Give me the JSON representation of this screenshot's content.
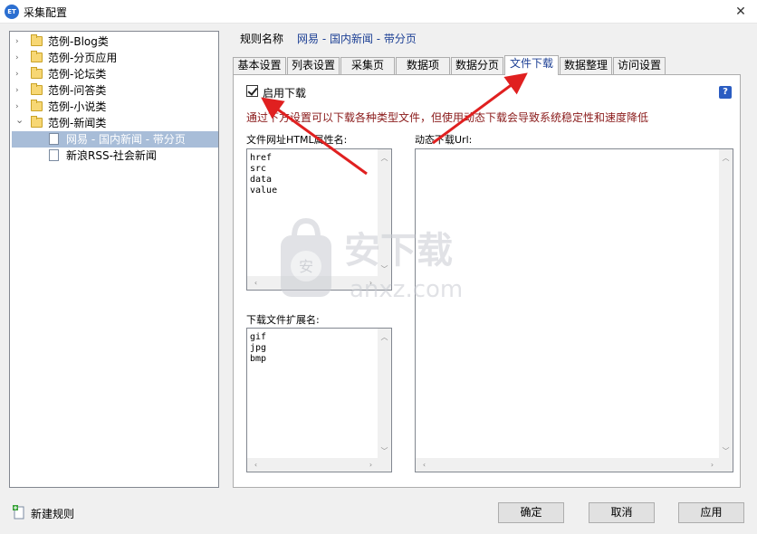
{
  "window": {
    "icon_text": "ET",
    "title": "采集配置",
    "close_glyph": "✕"
  },
  "tree": {
    "items": [
      {
        "label": "范例-Blog类",
        "expanded": false
      },
      {
        "label": "范例-分页应用",
        "expanded": false
      },
      {
        "label": "范例-论坛类",
        "expanded": false
      },
      {
        "label": "范例-问答类",
        "expanded": false
      },
      {
        "label": "范例-小说类",
        "expanded": false
      },
      {
        "label": "范例-新闻类",
        "expanded": true
      },
      {
        "label": "网易 - 国内新闻 - 带分页",
        "selected": true
      },
      {
        "label": "新浪RSS-社会新闻",
        "selected": false
      }
    ],
    "collapsed_glyph": "›",
    "expanded_glyph": "⌄"
  },
  "rule": {
    "label": "规则名称",
    "value": "网易 - 国内新闻 - 带分页"
  },
  "tabs": [
    {
      "label": "基本设置"
    },
    {
      "label": "列表设置"
    },
    {
      "label": "采集页"
    },
    {
      "label": "数据项"
    },
    {
      "label": "数据分页"
    },
    {
      "label": "文件下载",
      "active": true
    },
    {
      "label": "数据整理"
    },
    {
      "label": "访问设置"
    }
  ],
  "download": {
    "enable_label": "启用下载",
    "enable_checked": true,
    "help_glyph": "?",
    "warning": "通过下方设置可以下载各种类型文件，但使用动态下载会导致系统稳定性和速度降低",
    "attr_label": "文件网址HTML属性名:",
    "attr_values": "href\nsrc\ndata\nvalue",
    "dynamic_label": "动态下载Url:",
    "dynamic_values": "",
    "ext_label": "下载文件扩展名:",
    "ext_values": "gif\njpg\nbmp"
  },
  "watermark": {
    "text": "安下载",
    "url": "anxz.com",
    "badge": "安"
  },
  "footer": {
    "new_rule_label": "新建规则",
    "ok_label": "确定",
    "cancel_label": "取消",
    "apply_label": "应用"
  },
  "colors": {
    "accent": "#1c3f94",
    "warning": "#8a1a1a",
    "annotation_arrow": "#e02020",
    "selection": "#a8bdd8"
  }
}
